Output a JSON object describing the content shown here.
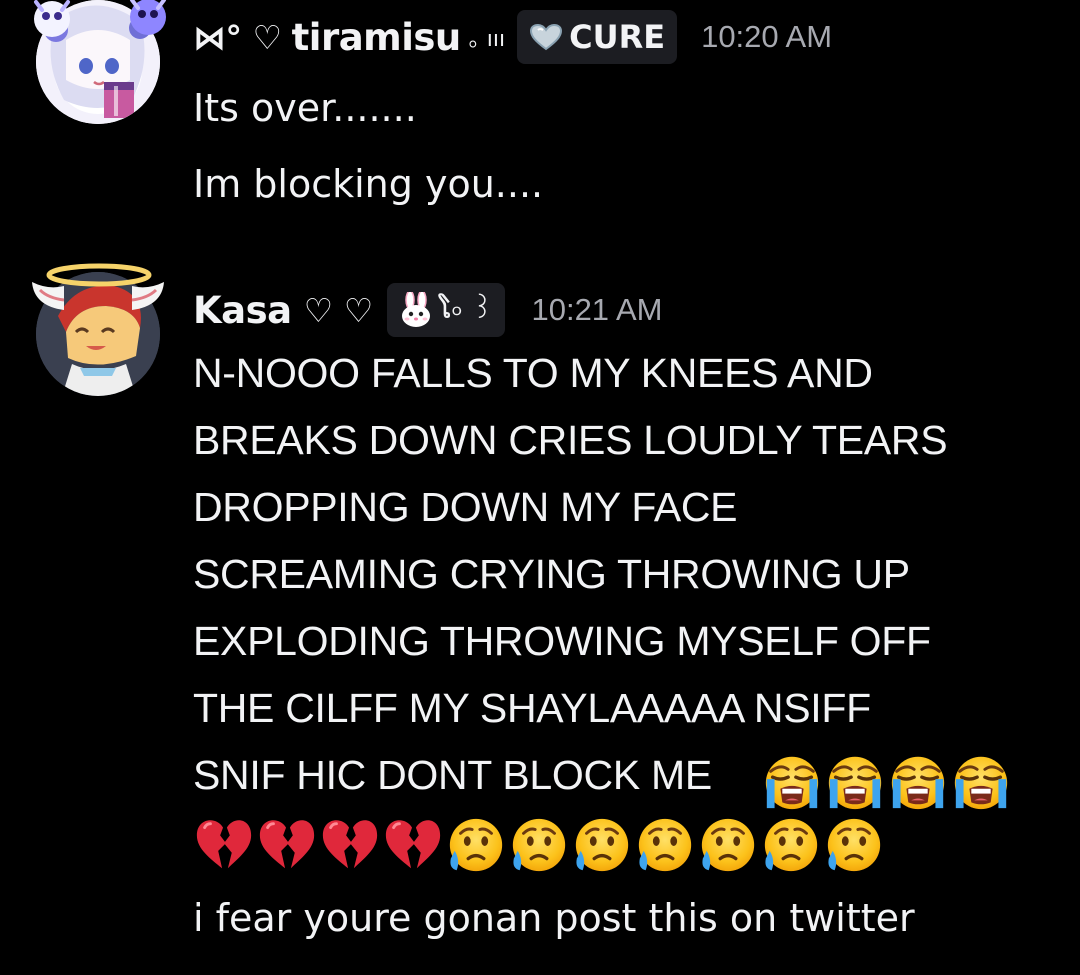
{
  "messages": [
    {
      "username": "tiramisu",
      "name_prefix": "⋈° ♡",
      "name_suffix": "｡ ııı",
      "tag": {
        "icon": "heart-icon",
        "label": "CURE"
      },
      "timestamp": "10:20 AM",
      "lines": [
        "Its over.......",
        "Im blocking you...."
      ]
    },
    {
      "username": "Kasa",
      "name_suffix": "♡ ♡",
      "tag": {
        "icon": "bunny-icon",
        "label": "ໂ৹ ꒱"
      },
      "timestamp": "10:21 AM",
      "lines": [
        "N-NOOO FALLS TO MY KNEES AND",
        "BREAKS DOWN CRIES LOUDLY TEARS",
        "DROPPING DOWN MY FACE",
        "SCREAMING CRYING THROWING UP",
        "EXPLODING THROWING MYSELF OFF",
        "THE CILFF MY SHAYLAAAAA NSIFF",
        "SNIF HIC DONT BLOCK ME"
      ],
      "emoji_line_1": [
        "loudly-crying-face",
        "loudly-crying-face",
        "loudly-crying-face",
        "loudly-crying-face"
      ],
      "emoji_line_2": [
        "broken-heart",
        "broken-heart",
        "broken-heart",
        "broken-heart",
        "sad-but-relieved-face",
        "sad-but-relieved-face",
        "sad-but-relieved-face",
        "sad-but-relieved-face",
        "sad-but-relieved-face",
        "sad-but-relieved-face",
        "sad-but-relieved-face"
      ],
      "last_line": "i fear youre gonan post this on twitter"
    }
  ],
  "colors": {
    "background": "#000000",
    "text": "#f2f3f5",
    "timestamp": "#a7a9b0",
    "tag_bg": "#1c1d22"
  }
}
